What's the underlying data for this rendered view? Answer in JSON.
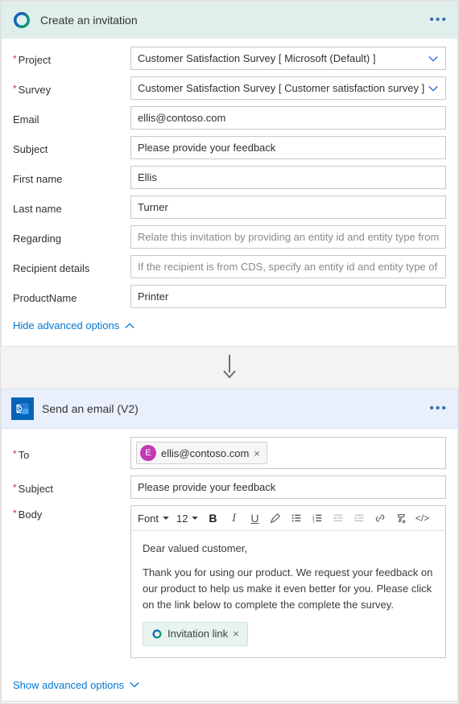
{
  "invitation": {
    "title": "Create an invitation",
    "fields": {
      "project": {
        "label": "Project",
        "required": true,
        "value": "Customer Satisfaction Survey [ Microsoft (Default) ]"
      },
      "survey": {
        "label": "Survey",
        "required": true,
        "value": "Customer Satisfaction Survey [ Customer satisfaction survey ]"
      },
      "email": {
        "label": "Email",
        "value": "ellis@contoso.com"
      },
      "subject": {
        "label": "Subject",
        "value": "Please provide your feedback"
      },
      "firstname": {
        "label": "First name",
        "value": "Ellis"
      },
      "lastname": {
        "label": "Last name",
        "value": "Turner"
      },
      "regarding": {
        "label": "Regarding",
        "placeholder": "Relate this invitation by providing an entity id and entity type from this CDS in t"
      },
      "recipient": {
        "label": "Recipient details",
        "placeholder": "If the recipient is from CDS, specify an entity id and entity type of the recipient t"
      },
      "productname": {
        "label": "ProductName",
        "value": "Printer"
      }
    },
    "hide_link": "Hide advanced options"
  },
  "email": {
    "title": "Send an email (V2)",
    "fields": {
      "to": {
        "label": "To",
        "chip_initial": "E",
        "chip_value": "ellis@contoso.com"
      },
      "subject": {
        "label": "Subject",
        "value": "Please provide your feedback"
      },
      "body": {
        "label": "Body"
      }
    },
    "toolbar": {
      "font": "Font",
      "size": "12"
    },
    "body_greeting": "Dear valued customer,",
    "body_text": "Thank you for using our product. We request your feedback on our product to help us make it even better for you. Please click on the link below to complete the complete the survey.",
    "body_chip": "Invitation link",
    "show_link": "Show advanced options"
  }
}
